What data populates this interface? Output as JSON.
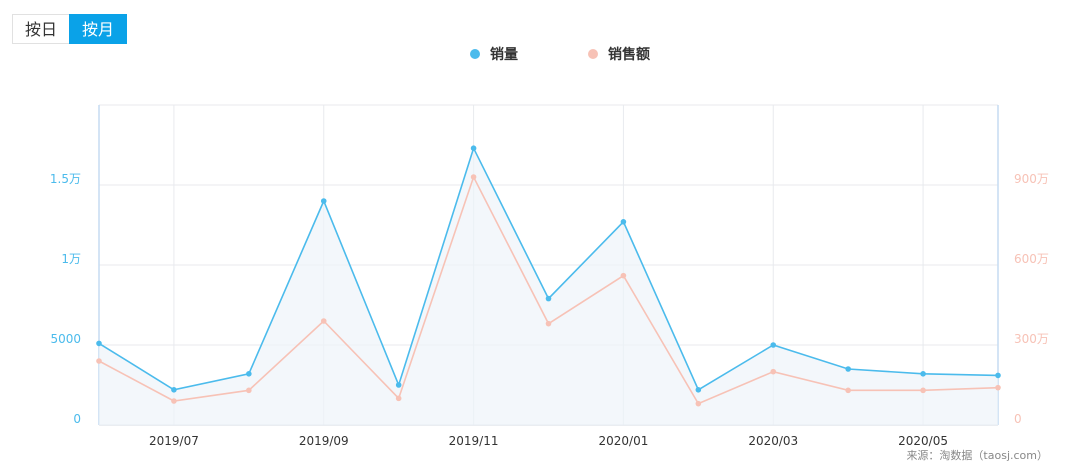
{
  "toggle": {
    "day_label": "按日",
    "month_label": "按月",
    "selected": "month"
  },
  "legend": [
    {
      "label": "销量",
      "color": "#4bbbec"
    },
    {
      "label": "销售额",
      "color": "#f7c2b6"
    }
  ],
  "source_text": "来源：淘数据（taosj.com）",
  "chart_data": {
    "type": "line",
    "x": [
      "2019/06",
      "2019/07",
      "2019/08",
      "2019/09",
      "2019/10",
      "2019/11",
      "2019/12",
      "2020/01",
      "2020/02",
      "2020/03",
      "2020/04",
      "2020/05",
      "2020/06"
    ],
    "x_tick_labels": [
      "2019/07",
      "2019/09",
      "2019/11",
      "2020/01",
      "2020/03",
      "2020/05"
    ],
    "series": [
      {
        "name": "销量",
        "axis": "left",
        "color": "#4bbbec",
        "values": [
          5100,
          2200,
          3200,
          14000,
          2500,
          17300,
          7900,
          12700,
          2200,
          5000,
          3500,
          3200,
          3100
        ]
      },
      {
        "name": "销售额",
        "axis": "right",
        "color": "#f7c2b6",
        "values": [
          2400000,
          900000,
          1300000,
          3900000,
          1000000,
          9300000,
          3800000,
          5600000,
          800000,
          2000000,
          1300000,
          1300000,
          1400000
        ]
      }
    ],
    "y_left": {
      "ticks": [
        "0",
        "5000",
        "1万",
        "1.5万"
      ],
      "range": [
        0,
        20000
      ],
      "color": "#4bbbec"
    },
    "y_right": {
      "ticks": [
        "0",
        "300万",
        "600万",
        "900万"
      ],
      "range": [
        0,
        12000000
      ],
      "color": "#f7c2b6"
    },
    "grid": true,
    "legend_position": "top-center"
  }
}
